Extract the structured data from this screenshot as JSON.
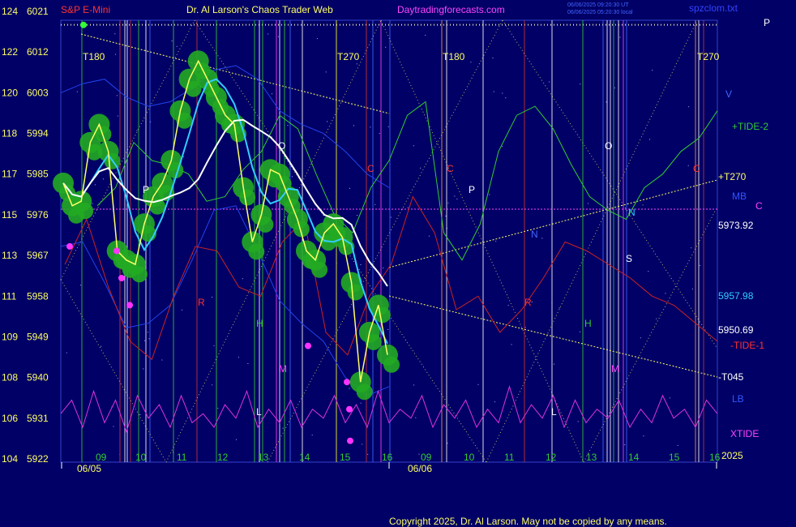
{
  "header": {
    "symbol": "S&P E-Mini",
    "title": "Dr. Al Larson's Chaos Trader Web",
    "site": "Daytradingforecasts.com",
    "stamp1": "06/06/2025 09:20:30 UT",
    "stamp2": "06/06/2025 05:20:30 local",
    "file": "spzclom.txt"
  },
  "footer": {
    "copyright": "Copyright 2025, Dr. Al Larson. May not be copied by any means."
  },
  "colors": {
    "background": "#000066",
    "price_bubbles": "#22aa22",
    "price_bar": "#ffff66",
    "avg_cyan": "#33ccff",
    "avg_white": "#ffffff",
    "tide_green": "#33cc33",
    "tide_red": "#cc2222",
    "xtide": "#dd33dd",
    "band_blue": "#2244ee"
  },
  "chart_data": {
    "type": "line",
    "y_left_ticks": [
      "104",
      "106",
      "108",
      "109",
      "111",
      "113",
      "115",
      "117",
      "118",
      "120",
      "122",
      "124"
    ],
    "y_price_ticks": [
      5922,
      5931,
      5940,
      5949,
      5958,
      5967,
      5976,
      5985,
      5994,
      6003,
      6012,
      6021
    ],
    "ylim": [
      5922,
      6021
    ],
    "x_hour_labels": [
      "09",
      "10",
      "11",
      "12",
      "13",
      "14",
      "15",
      "16",
      "09",
      "10",
      "11",
      "12",
      "13",
      "14",
      "15",
      "16"
    ],
    "x_date_labels": [
      "06/05",
      "06/06"
    ],
    "x_year": "2025",
    "right_labels": [
      "P",
      "V",
      "+TIDE-2",
      "+T270",
      "MB",
      "C",
      "5973.92",
      "5957.98",
      "5950.69",
      "-TIDE-1",
      "-T045",
      "LB",
      "XTIDE"
    ],
    "vline_labels": [
      "T180",
      "T270",
      "T180",
      "T270"
    ],
    "letter_annotations": [
      "P",
      "O",
      "C",
      "C",
      "P",
      "O",
      "R",
      "R",
      "H",
      "H",
      "M",
      "M",
      "L",
      "L",
      "N",
      "S",
      "N",
      "C"
    ],
    "series": [
      {
        "name": "price",
        "values": [
          5983,
          5978,
          5979,
          5992,
          5996,
          5990,
          5968,
          5966,
          5965,
          5974,
          5980,
          5983,
          5988,
          5999,
          6006,
          6010,
          6006,
          6002,
          5998,
          5996,
          5982,
          5970,
          5976,
          5986,
          5985,
          5980,
          5975,
          5968,
          5966,
          5972,
          5974,
          5971,
          5961,
          5939,
          5950,
          5956,
          5945
        ]
      },
      {
        "name": "+TIDE-2",
        "values": [
          5978,
          5982,
          5992,
          5988,
          5987,
          5985,
          5979,
          5980,
          5986,
          5990,
          5998,
          5995,
          5985,
          5976,
          5972,
          5982,
          5988,
          5998,
          6001,
          5972,
          5966,
          5974,
          5990,
          5998,
          6000,
          5995,
          5987,
          5980,
          5977,
          5975,
          5982,
          5985,
          5990,
          5993,
          5999
        ]
      },
      {
        "name": "-TIDE-1",
        "values": [
          5965,
          5975,
          5960,
          5948,
          5944,
          5958,
          5969,
          5968,
          5960,
          5958,
          5970,
          5975,
          5950,
          5945,
          5958,
          5965,
          5980,
          5972,
          5955,
          5958,
          5950,
          5955,
          5962,
          5970,
          5968,
          5965,
          5962,
          5958,
          5956,
          5952,
          5948
        ]
      },
      {
        "name": "XTIDE",
        "values": [
          5932,
          5935,
          5929,
          5937,
          5930,
          5935,
          5928,
          5936,
          5931,
          5934,
          5929,
          5936,
          5930,
          5932,
          5929,
          5934,
          5931,
          5937,
          5929,
          5933,
          5930,
          5935,
          5929,
          5933,
          5931,
          5936,
          5930,
          5934,
          5929,
          5937,
          5930,
          5933,
          5931,
          5936,
          5929,
          5934,
          5931,
          5935,
          5929,
          5933,
          5930,
          5938,
          5930,
          5934,
          5931,
          5936,
          5929,
          5935,
          5930,
          5933,
          5931,
          5935,
          5929,
          5933,
          5930,
          5936,
          5931,
          5933,
          5929,
          5935,
          5932
        ]
      }
    ]
  }
}
